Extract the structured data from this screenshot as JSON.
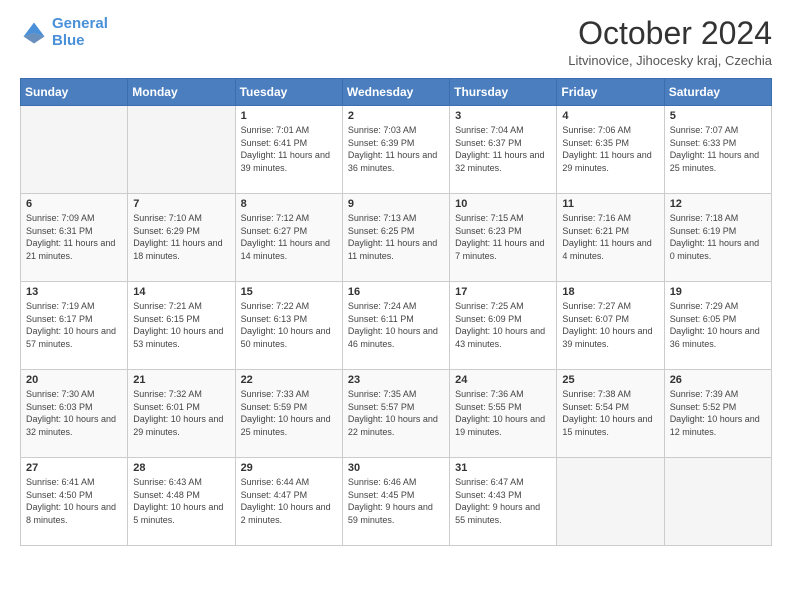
{
  "header": {
    "logo_line1": "General",
    "logo_line2": "Blue",
    "month_title": "October 2024",
    "location": "Litvinovice, Jihocesky kraj, Czechia"
  },
  "days_of_week": [
    "Sunday",
    "Monday",
    "Tuesday",
    "Wednesday",
    "Thursday",
    "Friday",
    "Saturday"
  ],
  "weeks": [
    [
      {
        "day": "",
        "info": ""
      },
      {
        "day": "",
        "info": ""
      },
      {
        "day": "1",
        "info": "Sunrise: 7:01 AM\nSunset: 6:41 PM\nDaylight: 11 hours and 39 minutes."
      },
      {
        "day": "2",
        "info": "Sunrise: 7:03 AM\nSunset: 6:39 PM\nDaylight: 11 hours and 36 minutes."
      },
      {
        "day": "3",
        "info": "Sunrise: 7:04 AM\nSunset: 6:37 PM\nDaylight: 11 hours and 32 minutes."
      },
      {
        "day": "4",
        "info": "Sunrise: 7:06 AM\nSunset: 6:35 PM\nDaylight: 11 hours and 29 minutes."
      },
      {
        "day": "5",
        "info": "Sunrise: 7:07 AM\nSunset: 6:33 PM\nDaylight: 11 hours and 25 minutes."
      }
    ],
    [
      {
        "day": "6",
        "info": "Sunrise: 7:09 AM\nSunset: 6:31 PM\nDaylight: 11 hours and 21 minutes."
      },
      {
        "day": "7",
        "info": "Sunrise: 7:10 AM\nSunset: 6:29 PM\nDaylight: 11 hours and 18 minutes."
      },
      {
        "day": "8",
        "info": "Sunrise: 7:12 AM\nSunset: 6:27 PM\nDaylight: 11 hours and 14 minutes."
      },
      {
        "day": "9",
        "info": "Sunrise: 7:13 AM\nSunset: 6:25 PM\nDaylight: 11 hours and 11 minutes."
      },
      {
        "day": "10",
        "info": "Sunrise: 7:15 AM\nSunset: 6:23 PM\nDaylight: 11 hours and 7 minutes."
      },
      {
        "day": "11",
        "info": "Sunrise: 7:16 AM\nSunset: 6:21 PM\nDaylight: 11 hours and 4 minutes."
      },
      {
        "day": "12",
        "info": "Sunrise: 7:18 AM\nSunset: 6:19 PM\nDaylight: 11 hours and 0 minutes."
      }
    ],
    [
      {
        "day": "13",
        "info": "Sunrise: 7:19 AM\nSunset: 6:17 PM\nDaylight: 10 hours and 57 minutes."
      },
      {
        "day": "14",
        "info": "Sunrise: 7:21 AM\nSunset: 6:15 PM\nDaylight: 10 hours and 53 minutes."
      },
      {
        "day": "15",
        "info": "Sunrise: 7:22 AM\nSunset: 6:13 PM\nDaylight: 10 hours and 50 minutes."
      },
      {
        "day": "16",
        "info": "Sunrise: 7:24 AM\nSunset: 6:11 PM\nDaylight: 10 hours and 46 minutes."
      },
      {
        "day": "17",
        "info": "Sunrise: 7:25 AM\nSunset: 6:09 PM\nDaylight: 10 hours and 43 minutes."
      },
      {
        "day": "18",
        "info": "Sunrise: 7:27 AM\nSunset: 6:07 PM\nDaylight: 10 hours and 39 minutes."
      },
      {
        "day": "19",
        "info": "Sunrise: 7:29 AM\nSunset: 6:05 PM\nDaylight: 10 hours and 36 minutes."
      }
    ],
    [
      {
        "day": "20",
        "info": "Sunrise: 7:30 AM\nSunset: 6:03 PM\nDaylight: 10 hours and 32 minutes."
      },
      {
        "day": "21",
        "info": "Sunrise: 7:32 AM\nSunset: 6:01 PM\nDaylight: 10 hours and 29 minutes."
      },
      {
        "day": "22",
        "info": "Sunrise: 7:33 AM\nSunset: 5:59 PM\nDaylight: 10 hours and 25 minutes."
      },
      {
        "day": "23",
        "info": "Sunrise: 7:35 AM\nSunset: 5:57 PM\nDaylight: 10 hours and 22 minutes."
      },
      {
        "day": "24",
        "info": "Sunrise: 7:36 AM\nSunset: 5:55 PM\nDaylight: 10 hours and 19 minutes."
      },
      {
        "day": "25",
        "info": "Sunrise: 7:38 AM\nSunset: 5:54 PM\nDaylight: 10 hours and 15 minutes."
      },
      {
        "day": "26",
        "info": "Sunrise: 7:39 AM\nSunset: 5:52 PM\nDaylight: 10 hours and 12 minutes."
      }
    ],
    [
      {
        "day": "27",
        "info": "Sunrise: 6:41 AM\nSunset: 4:50 PM\nDaylight: 10 hours and 8 minutes."
      },
      {
        "day": "28",
        "info": "Sunrise: 6:43 AM\nSunset: 4:48 PM\nDaylight: 10 hours and 5 minutes."
      },
      {
        "day": "29",
        "info": "Sunrise: 6:44 AM\nSunset: 4:47 PM\nDaylight: 10 hours and 2 minutes."
      },
      {
        "day": "30",
        "info": "Sunrise: 6:46 AM\nSunset: 4:45 PM\nDaylight: 9 hours and 59 minutes."
      },
      {
        "day": "31",
        "info": "Sunrise: 6:47 AM\nSunset: 4:43 PM\nDaylight: 9 hours and 55 minutes."
      },
      {
        "day": "",
        "info": ""
      },
      {
        "day": "",
        "info": ""
      }
    ]
  ]
}
